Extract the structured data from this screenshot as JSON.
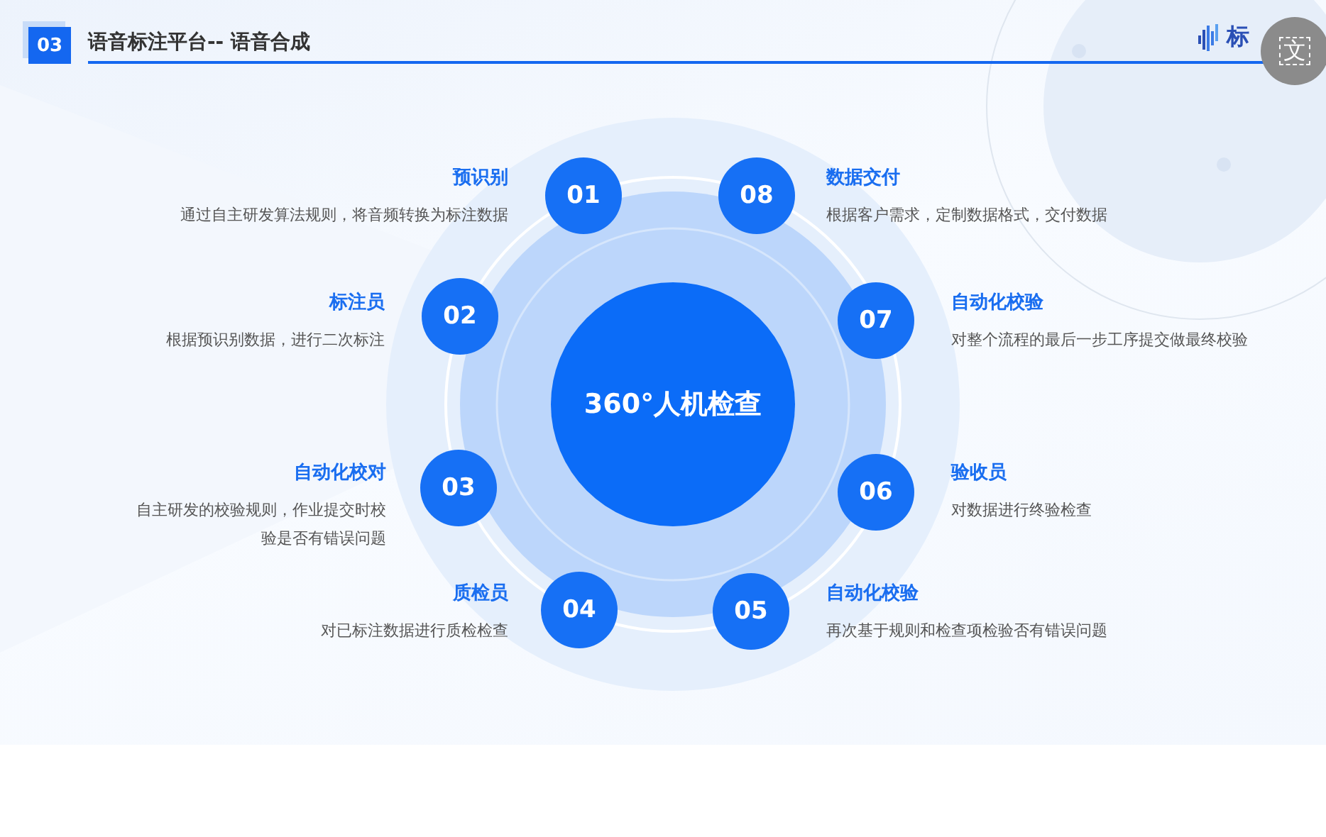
{
  "header": {
    "section_number": "03",
    "title": "语音标注平台-- 语音合成",
    "logo_text": "标"
  },
  "overlay_button": {
    "glyph": "文"
  },
  "center_label": "360°人机检查",
  "steps": [
    {
      "number": "01",
      "title": "预识别",
      "description": [
        "通过自主研发算法规则，将音频转换为标注数据"
      ]
    },
    {
      "number": "08",
      "title": "数据交付",
      "description": [
        "根据客户需求，定制数据格式，交付数据"
      ]
    },
    {
      "number": "02",
      "title": "标注员",
      "description": [
        "根据预识别数据，进行二次标注"
      ]
    },
    {
      "number": "07",
      "title": "自动化校验",
      "description": [
        "对整个流程的最后一步工序提交做最终校验"
      ]
    },
    {
      "number": "03",
      "title": "自动化校对",
      "description": [
        "自主研发的校验规则，作业提交时校",
        "验是否有错误问题"
      ]
    },
    {
      "number": "06",
      "title": "验收员",
      "description": [
        "对数据进行终验检查"
      ]
    },
    {
      "number": "04",
      "title": "质检员",
      "description": [
        "对已标注数据进行质检检查"
      ]
    },
    {
      "number": "05",
      "title": "自动化校验",
      "description": [
        "再次基于规则和检查项检验否有错误问题"
      ]
    }
  ]
}
